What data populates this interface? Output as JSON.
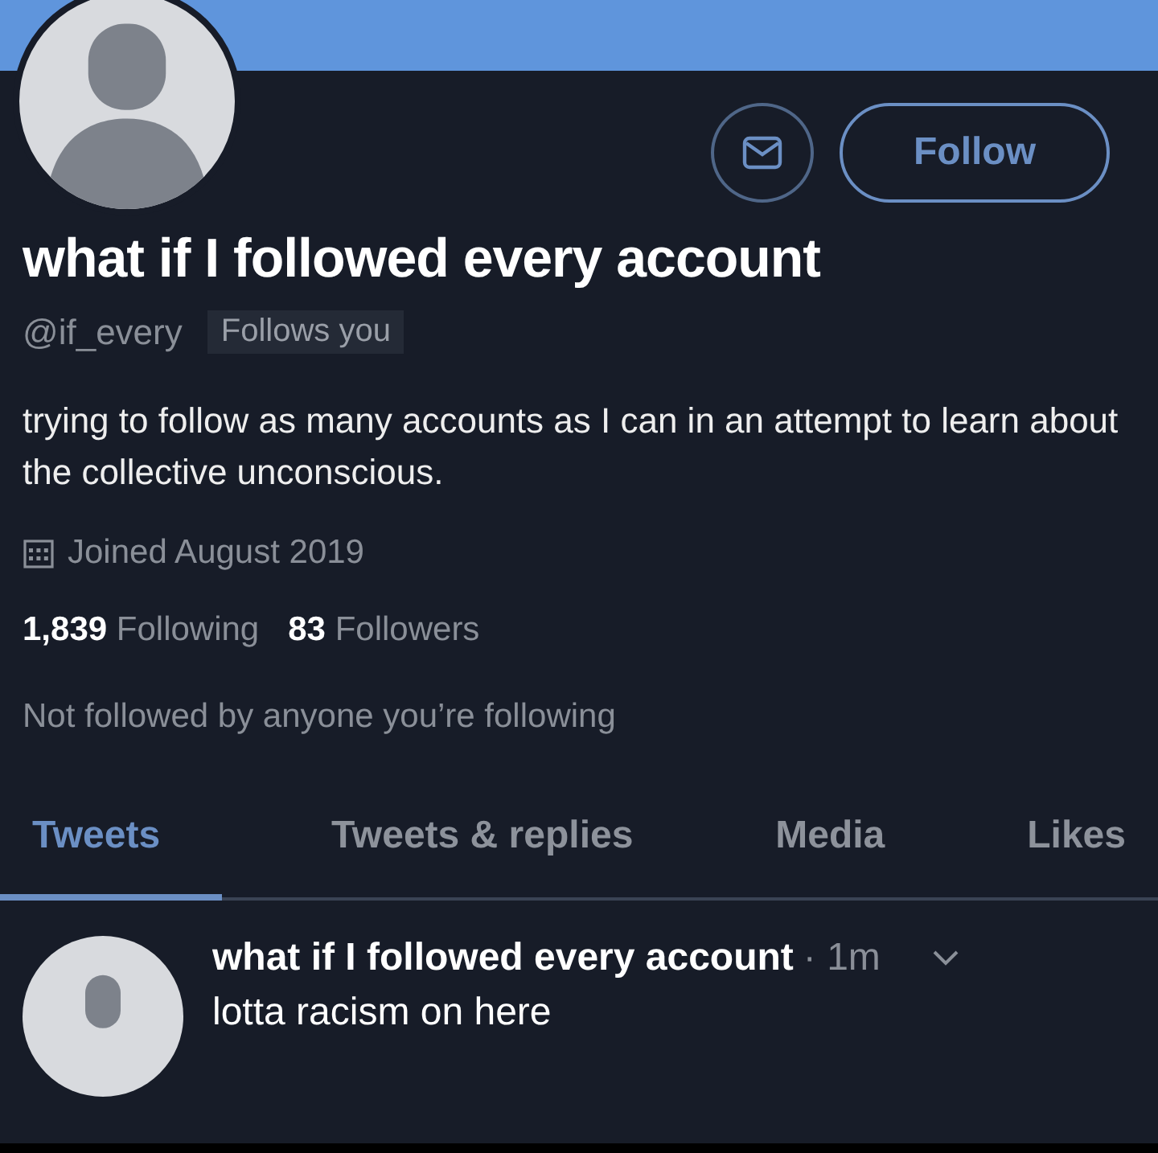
{
  "profile": {
    "name": "what if I followed every account",
    "handle": "@if_every",
    "follows_you_badge": "Follows you",
    "bio": "trying to follow as many accounts as I can in an attempt to learn about the collective unconscious.",
    "joined": "Joined August 2019",
    "following_count": "1,839",
    "following_label": "Following",
    "followers_count": "83",
    "followers_label": "Followers",
    "mutuals_note": "Not followed by anyone you’re following"
  },
  "actions": {
    "follow_button": "Follow"
  },
  "tabs": [
    {
      "label": "Tweets",
      "selected": true
    },
    {
      "label": "Tweets & replies",
      "selected": false
    },
    {
      "label": "Media",
      "selected": false
    },
    {
      "label": "Likes",
      "selected": false
    }
  ],
  "tweets": [
    {
      "author": "what if I followed every account",
      "time": "· 1m",
      "text": "lotta racism on here"
    }
  ]
}
